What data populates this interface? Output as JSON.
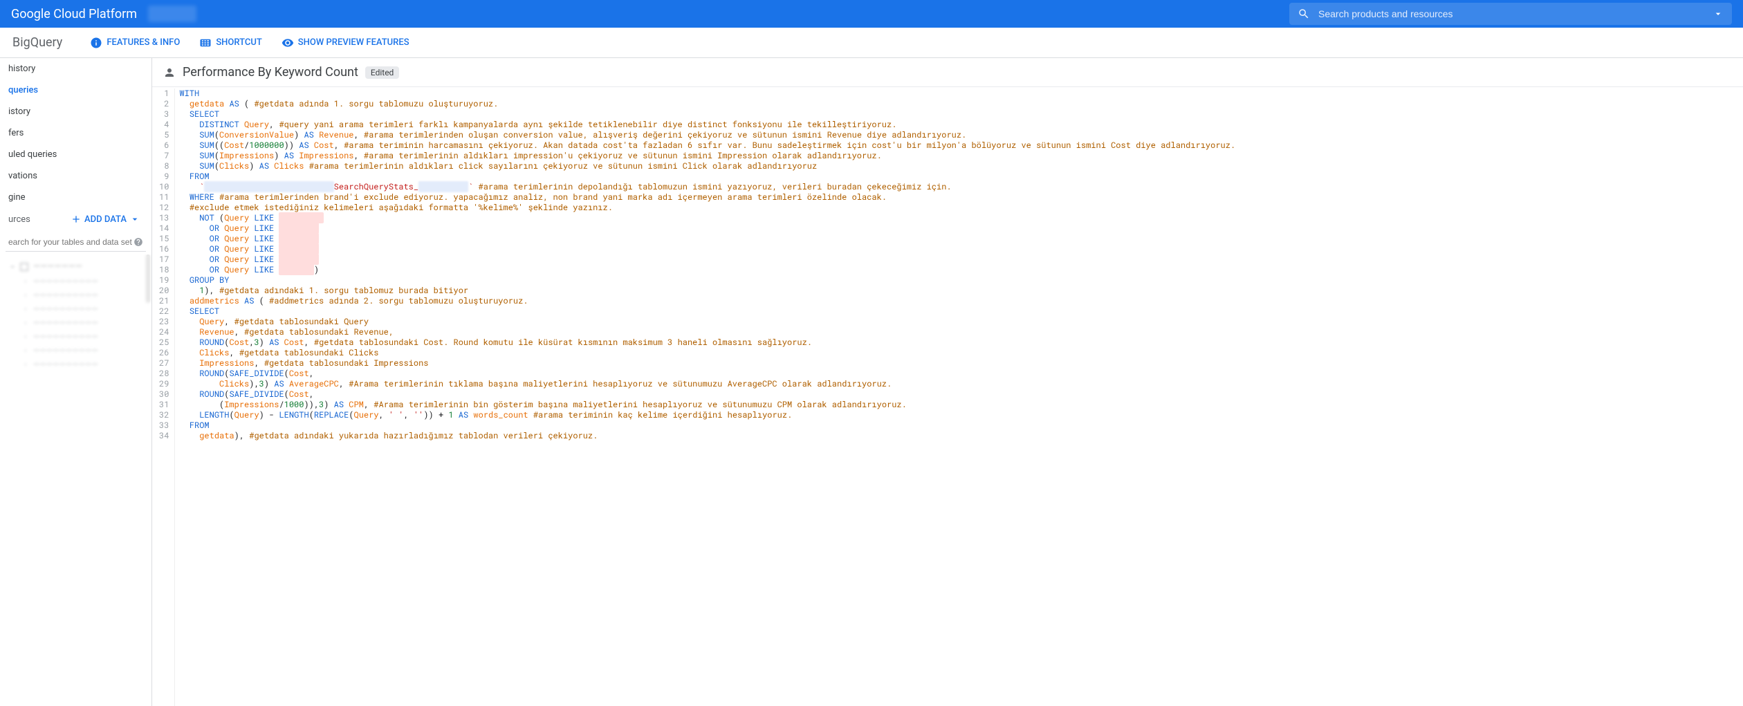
{
  "header": {
    "title": "Google Cloud Platform",
    "search_placeholder": "Search products and resources"
  },
  "subheader": {
    "product": "BigQuery",
    "features": "FEATURES & INFO",
    "shortcut": "SHORTCUT",
    "preview": "SHOW PREVIEW FEATURES"
  },
  "sidebar": {
    "items": [
      "history",
      "queries",
      "istory",
      "fers",
      "uled queries",
      "vations",
      "gine"
    ],
    "active_index": 1,
    "resources_label": "urces",
    "add_data": "ADD DATA",
    "search_placeholder": "earch for your tables and data sets",
    "tree_project": "———————",
    "tree_items": [
      "——————————",
      "——————————",
      "——————————",
      "——————————",
      "——————————",
      "——————————",
      "——————————"
    ]
  },
  "main": {
    "title": "Performance By Keyword Count",
    "badge": "Edited"
  },
  "code_lines": [
    [
      [
        "kw",
        "WITH"
      ]
    ],
    [
      [
        "pln",
        "  "
      ],
      [
        "id",
        "getdata"
      ],
      [
        "pln",
        " "
      ],
      [
        "kw",
        "AS"
      ],
      [
        "pln",
        " ( "
      ],
      [
        "com",
        "#getdata adında 1. sorgu tablomuzu oluşturuyoruz."
      ]
    ],
    [
      [
        "pln",
        "  "
      ],
      [
        "kw",
        "SELECT"
      ]
    ],
    [
      [
        "pln",
        "    "
      ],
      [
        "kw",
        "DISTINCT"
      ],
      [
        "pln",
        " "
      ],
      [
        "id",
        "Query"
      ],
      [
        "pln",
        ", "
      ],
      [
        "com",
        "#query yani arama terimleri farklı kampanyalarda aynı şekilde tetiklenebilir diye distinct fonksiyonu ile tekilleştiriyoruz."
      ]
    ],
    [
      [
        "pln",
        "    "
      ],
      [
        "fn",
        "SUM"
      ],
      [
        "pln",
        "("
      ],
      [
        "id",
        "ConversionValue"
      ],
      [
        "pln",
        ") "
      ],
      [
        "kw",
        "AS"
      ],
      [
        "pln",
        " "
      ],
      [
        "id",
        "Revenue"
      ],
      [
        "pln",
        ", "
      ],
      [
        "com",
        "#arama terimlerinden oluşan conversion value, alışveriş değerini çekiyoruz ve sütunun ismini Revenue diye adlandırıyoruz."
      ]
    ],
    [
      [
        "pln",
        "    "
      ],
      [
        "fn",
        "SUM"
      ],
      [
        "pln",
        "(("
      ],
      [
        "id",
        "Cost"
      ],
      [
        "pln",
        "/"
      ],
      [
        "num",
        "1000000"
      ],
      [
        "pln",
        ")) "
      ],
      [
        "kw",
        "AS"
      ],
      [
        "pln",
        " "
      ],
      [
        "id",
        "Cost"
      ],
      [
        "pln",
        ", "
      ],
      [
        "com",
        "#arama teriminin harcamasını çekiyoruz. Akan datada cost'ta fazladan 6 sıfır var. Bunu sadeleştirmek için cost'u bir milyon'a bölüyoruz ve sütunun ismini Cost diye adlandırıyoruz."
      ]
    ],
    [
      [
        "pln",
        "    "
      ],
      [
        "fn",
        "SUM"
      ],
      [
        "pln",
        "("
      ],
      [
        "id",
        "Impressions"
      ],
      [
        "pln",
        ") "
      ],
      [
        "kw",
        "AS"
      ],
      [
        "pln",
        " "
      ],
      [
        "id",
        "Impressions"
      ],
      [
        "pln",
        ", "
      ],
      [
        "com",
        "#arama terimlerinin aldıkları impression'u çekiyoruz ve sütunun ismini Impression olarak adlandırıyoruz."
      ]
    ],
    [
      [
        "pln",
        "    "
      ],
      [
        "fn",
        "SUM"
      ],
      [
        "pln",
        "("
      ],
      [
        "id",
        "Clicks"
      ],
      [
        "pln",
        ") "
      ],
      [
        "kw",
        "AS"
      ],
      [
        "pln",
        " "
      ],
      [
        "id",
        "Clicks"
      ],
      [
        "pln",
        " "
      ],
      [
        "com",
        "#arama terimlerinin aldıkları click sayılarını çekiyoruz ve sütunun ismini Click olarak adlandırıyoruz"
      ]
    ],
    [
      [
        "pln",
        "  "
      ],
      [
        "kw",
        "FROM"
      ]
    ],
    [
      [
        "pln",
        "    "
      ],
      [
        "str",
        "`"
      ],
      [
        "redact2",
        "                          "
      ],
      [
        "str",
        "SearchQueryStats_"
      ],
      [
        "redact2",
        "          "
      ],
      [
        "str",
        "`"
      ],
      [
        "pln",
        " "
      ],
      [
        "com",
        "#arama terimlerinin depolandığı tablomuzun ismini yazıyoruz, verileri buradan çekeceğimiz için."
      ]
    ],
    [
      [
        "pln",
        "  "
      ],
      [
        "kw",
        "WHERE"
      ],
      [
        "pln",
        " "
      ],
      [
        "com",
        "#arama terimlerinden brand'i exclude ediyoruz. yapacağımız analiz, non brand yani marka adı içermeyen arama terimleri özelinde olacak."
      ]
    ],
    [
      [
        "pln",
        "  "
      ],
      [
        "com",
        "#exclude etmek istediğiniz kelimeleri aşağıdaki formatta '%kelime%' şeklinde yazınız."
      ]
    ],
    [
      [
        "pln",
        "    "
      ],
      [
        "kw",
        "NOT"
      ],
      [
        "pln",
        " ("
      ],
      [
        "id",
        "Query"
      ],
      [
        "pln",
        " "
      ],
      [
        "kw",
        "LIKE"
      ],
      [
        "pln",
        " "
      ],
      [
        "redact",
        "'      %'"
      ]
    ],
    [
      [
        "pln",
        "      "
      ],
      [
        "kw",
        "OR"
      ],
      [
        "pln",
        " "
      ],
      [
        "id",
        "Query"
      ],
      [
        "pln",
        " "
      ],
      [
        "kw",
        "LIKE"
      ],
      [
        "pln",
        " "
      ],
      [
        "redact",
        "'      '"
      ]
    ],
    [
      [
        "pln",
        "      "
      ],
      [
        "kw",
        "OR"
      ],
      [
        "pln",
        " "
      ],
      [
        "id",
        "Query"
      ],
      [
        "pln",
        " "
      ],
      [
        "kw",
        "LIKE"
      ],
      [
        "pln",
        " "
      ],
      [
        "redact",
        "'      '"
      ]
    ],
    [
      [
        "pln",
        "      "
      ],
      [
        "kw",
        "OR"
      ],
      [
        "pln",
        " "
      ],
      [
        "id",
        "Query"
      ],
      [
        "pln",
        " "
      ],
      [
        "kw",
        "LIKE"
      ],
      [
        "pln",
        " "
      ],
      [
        "redact",
        "'      '"
      ]
    ],
    [
      [
        "pln",
        "      "
      ],
      [
        "kw",
        "OR"
      ],
      [
        "pln",
        " "
      ],
      [
        "id",
        "Query"
      ],
      [
        "pln",
        " "
      ],
      [
        "kw",
        "LIKE"
      ],
      [
        "pln",
        " "
      ],
      [
        "redact",
        "'      '"
      ]
    ],
    [
      [
        "pln",
        "      "
      ],
      [
        "kw",
        "OR"
      ],
      [
        "pln",
        " "
      ],
      [
        "id",
        "Query"
      ],
      [
        "pln",
        " "
      ],
      [
        "kw",
        "LIKE"
      ],
      [
        "pln",
        " "
      ],
      [
        "redact",
        "'     '"
      ],
      [
        "pln",
        ")"
      ]
    ],
    [
      [
        "pln",
        "  "
      ],
      [
        "kw",
        "GROUP BY"
      ]
    ],
    [
      [
        "pln",
        "    "
      ],
      [
        "num",
        "1"
      ],
      [
        "pln",
        "), "
      ],
      [
        "com",
        "#getdata adındaki 1. sorgu tablomuz burada bitiyor"
      ]
    ],
    [
      [
        "pln",
        "  "
      ],
      [
        "id",
        "addmetrics"
      ],
      [
        "pln",
        " "
      ],
      [
        "kw",
        "AS"
      ],
      [
        "pln",
        " ( "
      ],
      [
        "com",
        "#addmetrics adında 2. sorgu tablomuzu oluşturuyoruz."
      ]
    ],
    [
      [
        "pln",
        "  "
      ],
      [
        "kw",
        "SELECT"
      ]
    ],
    [
      [
        "pln",
        "    "
      ],
      [
        "id",
        "Query"
      ],
      [
        "pln",
        ", "
      ],
      [
        "com",
        "#getdata tablosundaki Query"
      ]
    ],
    [
      [
        "pln",
        "    "
      ],
      [
        "id",
        "Revenue"
      ],
      [
        "pln",
        ", "
      ],
      [
        "com",
        "#getdata tablosundaki Revenue,"
      ]
    ],
    [
      [
        "pln",
        "    "
      ],
      [
        "fn",
        "ROUND"
      ],
      [
        "pln",
        "("
      ],
      [
        "id",
        "Cost"
      ],
      [
        "pln",
        ","
      ],
      [
        "num",
        "3"
      ],
      [
        "pln",
        ") "
      ],
      [
        "kw",
        "AS"
      ],
      [
        "pln",
        " "
      ],
      [
        "id",
        "Cost"
      ],
      [
        "pln",
        ", "
      ],
      [
        "com",
        "#getdata tablosundaki Cost. Round komutu ile küsürat kısmının maksimum 3 haneli olmasını sağlıyoruz."
      ]
    ],
    [
      [
        "pln",
        "    "
      ],
      [
        "id",
        "Clicks"
      ],
      [
        "pln",
        ", "
      ],
      [
        "com",
        "#getdata tablosundaki Clicks"
      ]
    ],
    [
      [
        "pln",
        "    "
      ],
      [
        "id",
        "Impressions"
      ],
      [
        "pln",
        ", "
      ],
      [
        "com",
        "#getdata tablosundaki Impressions"
      ]
    ],
    [
      [
        "pln",
        "    "
      ],
      [
        "fn",
        "ROUND"
      ],
      [
        "pln",
        "("
      ],
      [
        "fn",
        "SAFE_DIVIDE"
      ],
      [
        "pln",
        "("
      ],
      [
        "id",
        "Cost"
      ],
      [
        "pln",
        ","
      ]
    ],
    [
      [
        "pln",
        "        "
      ],
      [
        "id",
        "Clicks"
      ],
      [
        "pln",
        "),"
      ],
      [
        "num",
        "3"
      ],
      [
        "pln",
        ") "
      ],
      [
        "kw",
        "AS"
      ],
      [
        "pln",
        " "
      ],
      [
        "id",
        "AverageCPC"
      ],
      [
        "pln",
        ", "
      ],
      [
        "com",
        "#Arama terimlerinin tıklama başına maliyetlerini hesaplıyoruz ve sütunumuzu AverageCPC olarak adlandırıyoruz."
      ]
    ],
    [
      [
        "pln",
        "    "
      ],
      [
        "fn",
        "ROUND"
      ],
      [
        "pln",
        "("
      ],
      [
        "fn",
        "SAFE_DIVIDE"
      ],
      [
        "pln",
        "("
      ],
      [
        "id",
        "Cost"
      ],
      [
        "pln",
        ","
      ]
    ],
    [
      [
        "pln",
        "        ("
      ],
      [
        "id",
        "Impressions"
      ],
      [
        "pln",
        "/"
      ],
      [
        "num",
        "1000"
      ],
      [
        "pln",
        ")),"
      ],
      [
        "num",
        "3"
      ],
      [
        "pln",
        ") "
      ],
      [
        "kw",
        "AS"
      ],
      [
        "pln",
        " "
      ],
      [
        "id",
        "CPM"
      ],
      [
        "pln",
        ", "
      ],
      [
        "com",
        "#Arama terimlerinin bin gösterim başına maliyetlerini hesaplıyoruz ve sütunumuzu CPM olarak adlandırıyoruz."
      ]
    ],
    [
      [
        "pln",
        "    "
      ],
      [
        "fn",
        "LENGTH"
      ],
      [
        "pln",
        "("
      ],
      [
        "id",
        "Query"
      ],
      [
        "pln",
        ") - "
      ],
      [
        "fn",
        "LENGTH"
      ],
      [
        "pln",
        "("
      ],
      [
        "fn",
        "REPLACE"
      ],
      [
        "pln",
        "("
      ],
      [
        "id",
        "Query"
      ],
      [
        "pln",
        ", "
      ],
      [
        "str",
        "' '"
      ],
      [
        "pln",
        ", "
      ],
      [
        "str",
        "''"
      ],
      [
        "pln",
        ")) + "
      ],
      [
        "num",
        "1"
      ],
      [
        "pln",
        " "
      ],
      [
        "kw",
        "AS"
      ],
      [
        "pln",
        " "
      ],
      [
        "id",
        "words_count"
      ],
      [
        "pln",
        " "
      ],
      [
        "com",
        "#arama teriminin kaç kelime içerdiğini hesaplıyoruz."
      ]
    ],
    [
      [
        "pln",
        "  "
      ],
      [
        "kw",
        "FROM"
      ]
    ],
    [
      [
        "pln",
        "    "
      ],
      [
        "id",
        "getdata"
      ],
      [
        "pln",
        "), "
      ],
      [
        "com",
        "#getdata adındaki yukarıda hazırladığımız tablodan verileri çekiyoruz."
      ]
    ]
  ]
}
